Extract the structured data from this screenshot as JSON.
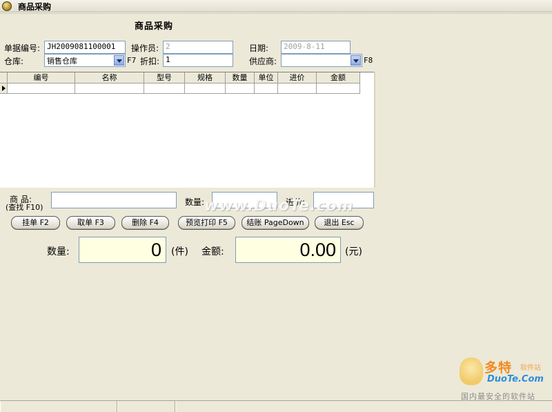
{
  "window": {
    "title": "商品采购"
  },
  "page_title": "商品采购",
  "form": {
    "order_no_label": "单据编号:",
    "order_no_value": "JH2009081100001",
    "operator_label": "操作员:",
    "operator_value": "2",
    "date_label": "日期:",
    "date_value": "2009-8-11",
    "warehouse_label": "仓库:",
    "warehouse_value": "销售仓库",
    "warehouse_shortcut": "F7",
    "discount_label": "折扣:",
    "discount_value": "1",
    "supplier_label": "供应商:",
    "supplier_value": "",
    "supplier_shortcut": "F8"
  },
  "grid": {
    "columns": [
      "编号",
      "名称",
      "型号",
      "规格",
      "数量",
      "单位",
      "进价",
      "金额"
    ],
    "rows": [
      [
        "",
        "",
        "",
        "",
        "",
        "",
        "",
        ""
      ]
    ]
  },
  "entry": {
    "product_label": "商  品:",
    "product_hint": "(查找 F10)",
    "product_value": "",
    "qty_label": "数量:",
    "qty_value": "",
    "price_label": "进价:",
    "price_value": ""
  },
  "buttons": {
    "hold": "挂单 F2",
    "retrieve": "取单 F3",
    "delete": "删除 F4",
    "preview_print": "预览打印 F5",
    "checkout": "结账 PageDown",
    "exit": "退出 Esc"
  },
  "totals": {
    "qty_label": "数量:",
    "qty_value": "0",
    "qty_unit": "(件)",
    "amount_label": "金额:",
    "amount_value": "0.00",
    "amount_unit": "(元)"
  },
  "watermark": {
    "text": "www.DuoTe.com"
  },
  "logo": {
    "title": "多特",
    "subtitle": "软件站",
    "domain": "DuoTe.Com",
    "slogan": "国内最安全的软件站"
  }
}
